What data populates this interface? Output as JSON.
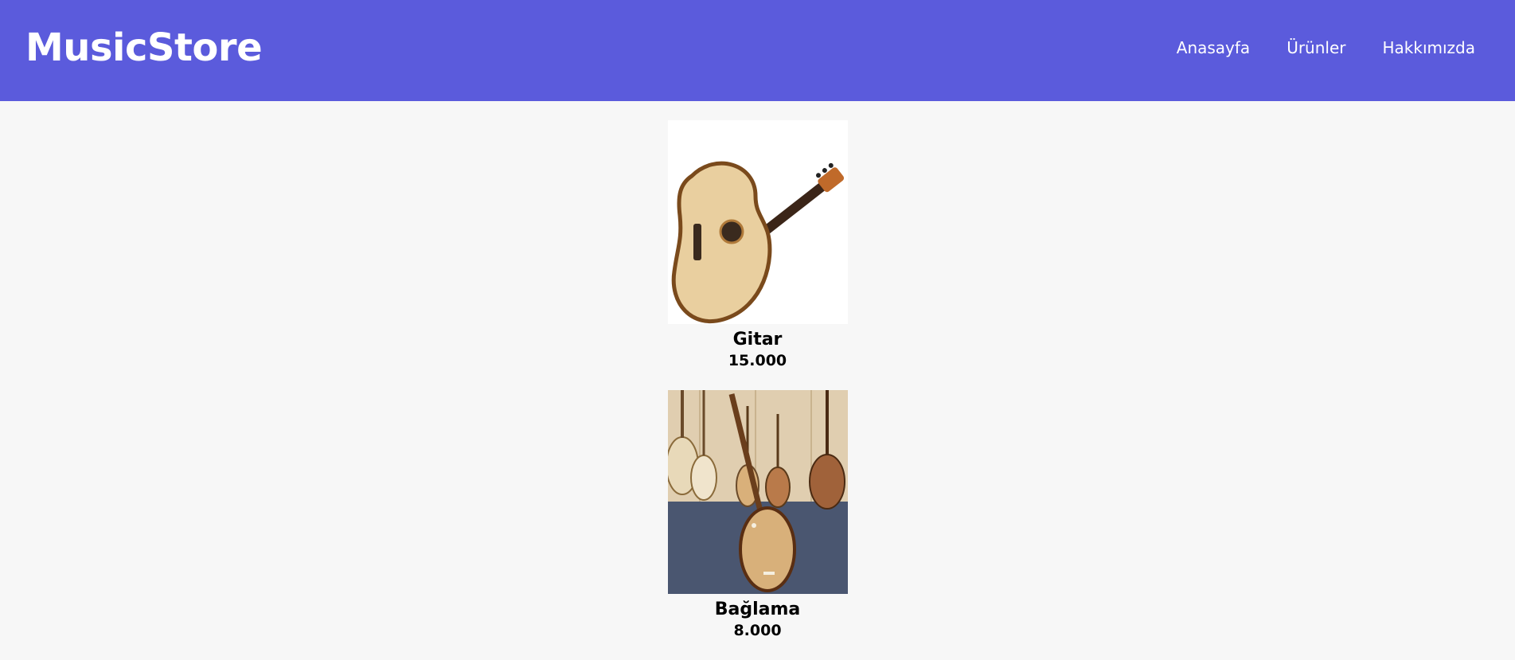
{
  "header": {
    "logo": "MusicStore",
    "nav": [
      "Anasayfa",
      "Ürünler",
      "Hakkımızda"
    ]
  },
  "products": [
    {
      "name": "Gitar",
      "price": "15.000",
      "image": "acoustic-guitar-photo"
    },
    {
      "name": "Bağlama",
      "price": "8.000",
      "image": "baglama-photo"
    }
  ],
  "colors": {
    "header_bg": "#5b5bdc",
    "page_bg": "#f7f7f7",
    "text": "#000000"
  }
}
